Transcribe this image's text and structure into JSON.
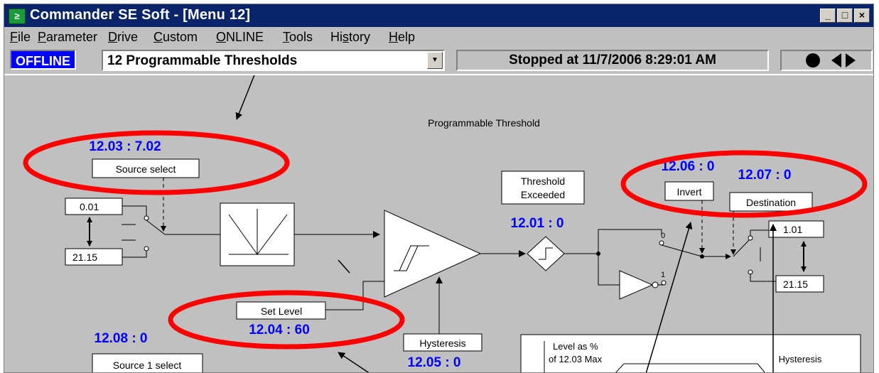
{
  "window": {
    "title": "Commander SE Soft - [Menu 12]",
    "app_icon": "commander-logo",
    "controls": [
      "_",
      "□",
      "×"
    ]
  },
  "menu": [
    {
      "label": "File",
      "accel": "F"
    },
    {
      "label": "Parameter",
      "accel": "P"
    },
    {
      "label": "Drive",
      "accel": "D"
    },
    {
      "label": "Custom",
      "accel": "C"
    },
    {
      "label": "ONLINE",
      "accel": "O"
    },
    {
      "label": "Tools",
      "accel": "T"
    },
    {
      "label": "History",
      "accel": "s"
    },
    {
      "label": "Help",
      "accel": "H"
    }
  ],
  "toolbar": {
    "mode": "OFFLINE",
    "menu_select": "12 Programmable Thresholds",
    "status": "Stopped at 11/7/2006 8:29:01 AM"
  },
  "diagram": {
    "title": "Programmable Threshold",
    "source_param": "12.03 : 7.02",
    "source_select": "Source select",
    "src_min": "0.01",
    "src_max": "21.15",
    "threshold_exceeded": "Threshold\nExceeded",
    "threshold_exceeded_l1": "Threshold",
    "threshold_exceeded_l2": "Exceeded",
    "threshold_param": "12.01 : 0",
    "invert_param": "12.06 : 0",
    "invert_label": "Invert",
    "dest_param": "12.07 : 0",
    "dest_label": "Destination",
    "dest_min": "1.01",
    "dest_max": "21.15",
    "switch_0": "0",
    "switch_1": "1",
    "set_level_label": "Set Level",
    "set_level_param": "12.04 : 60",
    "hysteresis_label": "Hysteresis",
    "hysteresis_param": "12.05 : 0",
    "source1_param": "12.08 : 0",
    "source1_label": "Source 1 select",
    "level_pct_l1": "Level as %",
    "level_pct_l2": "of 12.03 Max",
    "hysteresis_l": "Hysteresis"
  },
  "colors": {
    "param_blue": "#0000ff",
    "title_bar": "#0a246a",
    "annotation_red": "#ff0000"
  }
}
